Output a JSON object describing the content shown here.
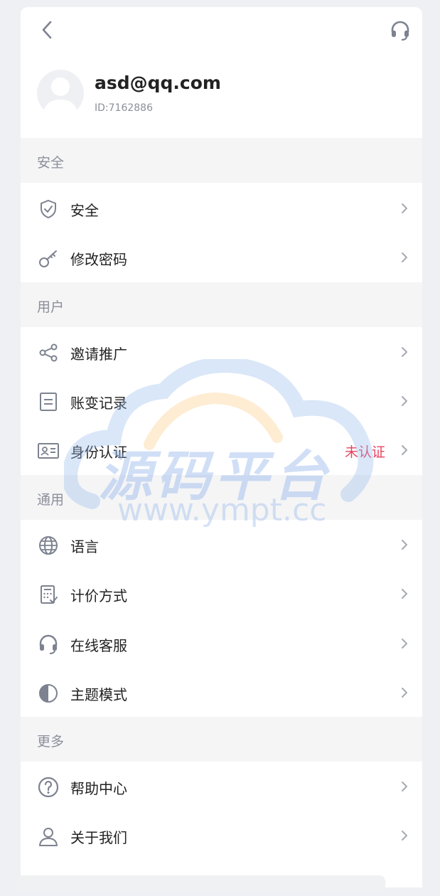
{
  "profile": {
    "email": "asd@qq.com",
    "id_text": "ID:7162886"
  },
  "sections": {
    "security": "安全",
    "user": "用户",
    "general": "通用",
    "more": "更多"
  },
  "items": {
    "security": "安全",
    "change_password": "修改密码",
    "invite": "邀请推广",
    "account_records": "账变记录",
    "identity": "身份认证",
    "identity_status": "未认证",
    "language": "语言",
    "pricing": "计价方式",
    "online_service": "在线客服",
    "theme": "主题模式",
    "help": "帮助中心",
    "about": "关于我们"
  },
  "watermark": {
    "text": "源码平台",
    "url": "www.ympt.cc"
  },
  "colors": {
    "status_unverified": "#e8415f",
    "icon": "#7d8290",
    "section_bg": "#f5f5f6"
  }
}
